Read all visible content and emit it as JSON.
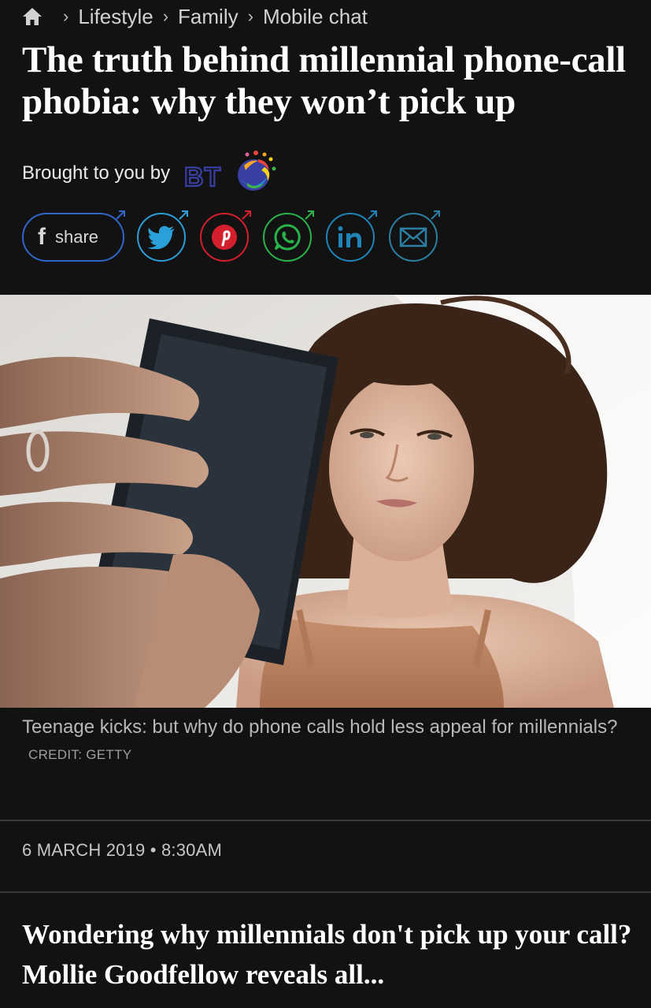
{
  "breadcrumb": {
    "home_icon": "home-icon",
    "items": [
      "Lifestyle",
      "Family",
      "Mobile chat"
    ]
  },
  "article": {
    "headline": "The truth behind millennial phone-call phobia: why they won’t pick up",
    "sponsor_label": "Brought to you by",
    "sponsor_logo_text": "BT",
    "share_label": "share",
    "caption": "Teenage kicks: but why do phone calls hold less appeal for millennials?",
    "credit": "CREDIT: GETTY",
    "date": "6 MARCH 2019 • 8:30AM",
    "standfirst": "Wondering why millennials don't pick up your call? Mollie Goodfellow reveals all..."
  },
  "share_buttons": [
    {
      "name": "facebook-icon",
      "color": "#2f66c7"
    },
    {
      "name": "twitter-icon",
      "color": "#2b9fd8"
    },
    {
      "name": "pinterest-icon",
      "color": "#d4202d"
    },
    {
      "name": "whatsapp-icon",
      "color": "#29b44a"
    },
    {
      "name": "linkedin-icon",
      "color": "#1f84b8"
    },
    {
      "name": "email-icon",
      "color": "#2c7fa4"
    }
  ],
  "colors": {
    "background": "#121212",
    "text": "#ffffff",
    "muted": "#b8b8b8",
    "bt_blue": "#3a3fa4"
  }
}
